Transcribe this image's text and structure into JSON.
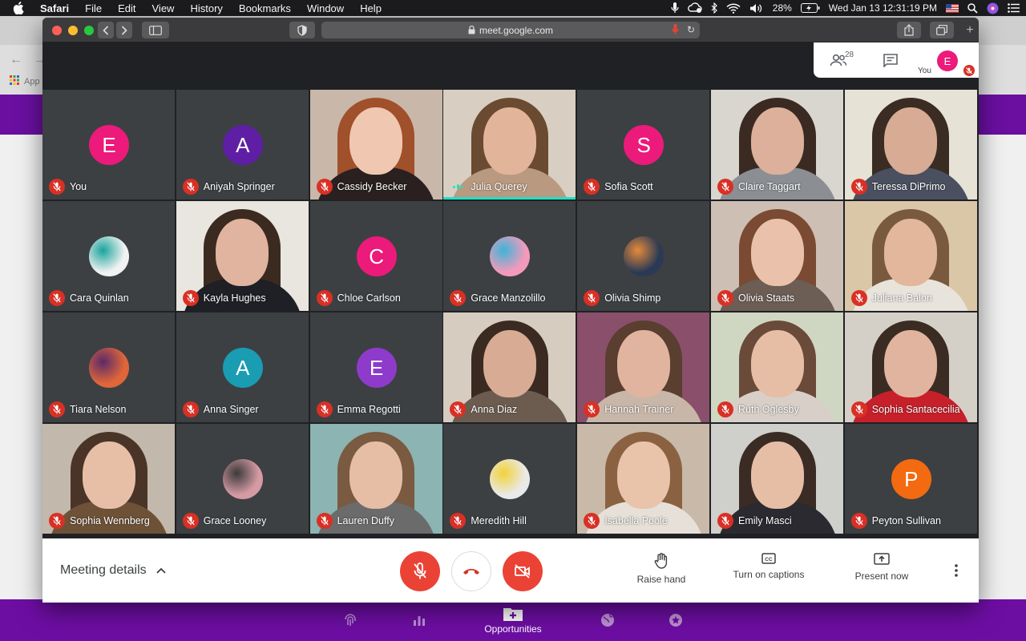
{
  "menubar": {
    "app": "Safari",
    "items": [
      "File",
      "Edit",
      "View",
      "History",
      "Bookmarks",
      "Window",
      "Help"
    ],
    "battery": "28%",
    "datetime": "Wed Jan 13  12:31:19 PM"
  },
  "background_browser": {
    "bookmarks_label": "App"
  },
  "background_footer": {
    "active_label": "Opportunities",
    "icons": [
      "fingerprint-icon",
      "bar-chart-icon",
      "add-folder-icon",
      "globe-icon",
      "star-badge-icon"
    ]
  },
  "browser": {
    "url": "meet.google.com"
  },
  "top_panel": {
    "people_count": "28",
    "you_initial": "E",
    "you_label": "You"
  },
  "participants": [
    {
      "name": "You",
      "initial": "E",
      "avatar_color": "#ec1a7a",
      "type": "avatar",
      "muted": true
    },
    {
      "name": "Aniyah Springer",
      "initial": "A",
      "avatar_color": "#5e1fa5",
      "type": "avatar",
      "muted": true
    },
    {
      "name": "Cassidy Becker",
      "type": "video",
      "muted": true
    },
    {
      "name": "Julia Querey",
      "type": "video",
      "muted": false,
      "speaking": true
    },
    {
      "name": "Sofia Scott",
      "initial": "S",
      "avatar_color": "#ec1a7a",
      "type": "avatar",
      "muted": true
    },
    {
      "name": "Claire Taggart",
      "type": "video",
      "muted": true
    },
    {
      "name": "Teressa DiPrimo",
      "type": "video",
      "muted": true
    },
    {
      "name": "Cara Quinlan",
      "type": "photo",
      "muted": true
    },
    {
      "name": "Kayla Hughes",
      "type": "video",
      "muted": true
    },
    {
      "name": "Chloe Carlson",
      "initial": "C",
      "avatar_color": "#ec1a7a",
      "type": "avatar",
      "muted": true
    },
    {
      "name": "Grace Manzolillo",
      "type": "photo",
      "muted": true
    },
    {
      "name": "Olivia Shimp",
      "type": "photo",
      "muted": true
    },
    {
      "name": "Olivia Staats",
      "type": "video",
      "muted": true
    },
    {
      "name": "Juliana Balon",
      "type": "video",
      "muted": true
    },
    {
      "name": "Tiara Nelson",
      "type": "photo",
      "muted": true
    },
    {
      "name": "Anna Singer",
      "initial": "A",
      "avatar_color": "#1a9cb3",
      "type": "avatar",
      "muted": true
    },
    {
      "name": "Emma Regotti",
      "initial": "E",
      "avatar_color": "#8e3bcc",
      "type": "avatar",
      "muted": true
    },
    {
      "name": "Anna Diaz",
      "type": "video",
      "muted": true
    },
    {
      "name": "Hannah Trainer",
      "type": "video",
      "muted": true
    },
    {
      "name": "Ruth Oglesby",
      "type": "video",
      "muted": true
    },
    {
      "name": "Sophia Santacecilia",
      "type": "video",
      "muted": true
    },
    {
      "name": "Sophia Wennberg",
      "type": "video",
      "muted": true
    },
    {
      "name": "Grace Looney",
      "type": "photo",
      "muted": true
    },
    {
      "name": "Lauren Duffy",
      "type": "video",
      "muted": true
    },
    {
      "name": "Meredith Hill",
      "type": "photo",
      "muted": true
    },
    {
      "name": "Isabella Poole",
      "type": "video",
      "muted": true
    },
    {
      "name": "Emily Masci",
      "type": "video",
      "muted": true
    },
    {
      "name": "Peyton Sullivan",
      "initial": "P",
      "avatar_color": "#f36a10",
      "type": "avatar",
      "muted": true
    }
  ],
  "controls": {
    "meeting_details": "Meeting details",
    "raise_hand": "Raise hand",
    "captions": "Turn on captions",
    "present": "Present now"
  }
}
